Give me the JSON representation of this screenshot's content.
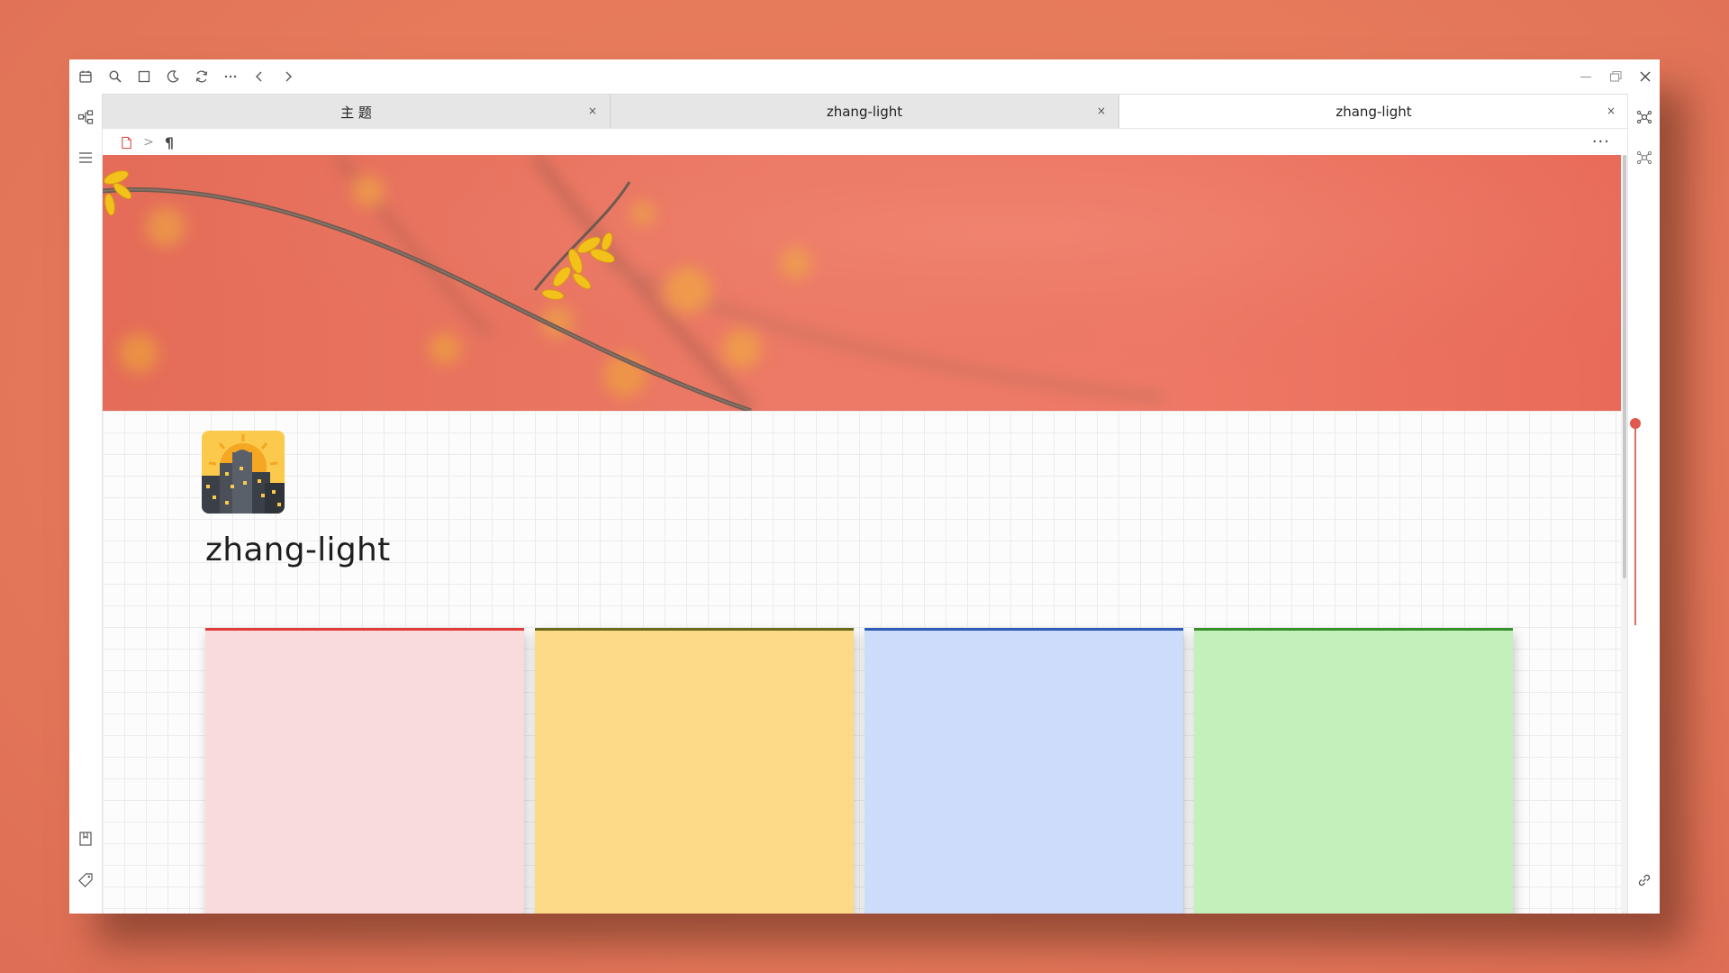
{
  "tabs": [
    {
      "label": "主 题",
      "close": "×"
    },
    {
      "label": "zhang-light",
      "close": "×"
    },
    {
      "label": "zhang-light",
      "close": "×"
    }
  ],
  "document": {
    "title": "zhang-light",
    "icon": "night-city-emoji",
    "banner": "wintersweet-branch-photo"
  },
  "breadcrumb": {
    "doc_icon": "file-icon",
    "separator": ">",
    "block_icon": "pilcrow",
    "pilcrow_glyph": "¶"
  },
  "toolbar": {
    "more_label": "···",
    "icons": [
      "calendar-icon",
      "search-icon",
      "square-icon",
      "moon-icon",
      "sync-icon",
      "more-icon",
      "back-icon",
      "forward-icon"
    ]
  },
  "window_controls": [
    "minimize-icon",
    "restore-icon",
    "close-icon"
  ],
  "cards": [
    {
      "name": "red-card",
      "fill": "#fadbdd",
      "accent": "#e03c3c"
    },
    {
      "name": "yellow-card",
      "fill": "#fdda88",
      "accent": "#6b6a1c"
    },
    {
      "name": "blue-card",
      "fill": "#cddcfb",
      "accent": "#2e5ab8"
    },
    {
      "name": "green-card",
      "fill": "#c4f0bb",
      "accent": "#3a8f2d"
    }
  ],
  "colors": {
    "background": "#e67a5b",
    "accent": "#e05a4c"
  }
}
